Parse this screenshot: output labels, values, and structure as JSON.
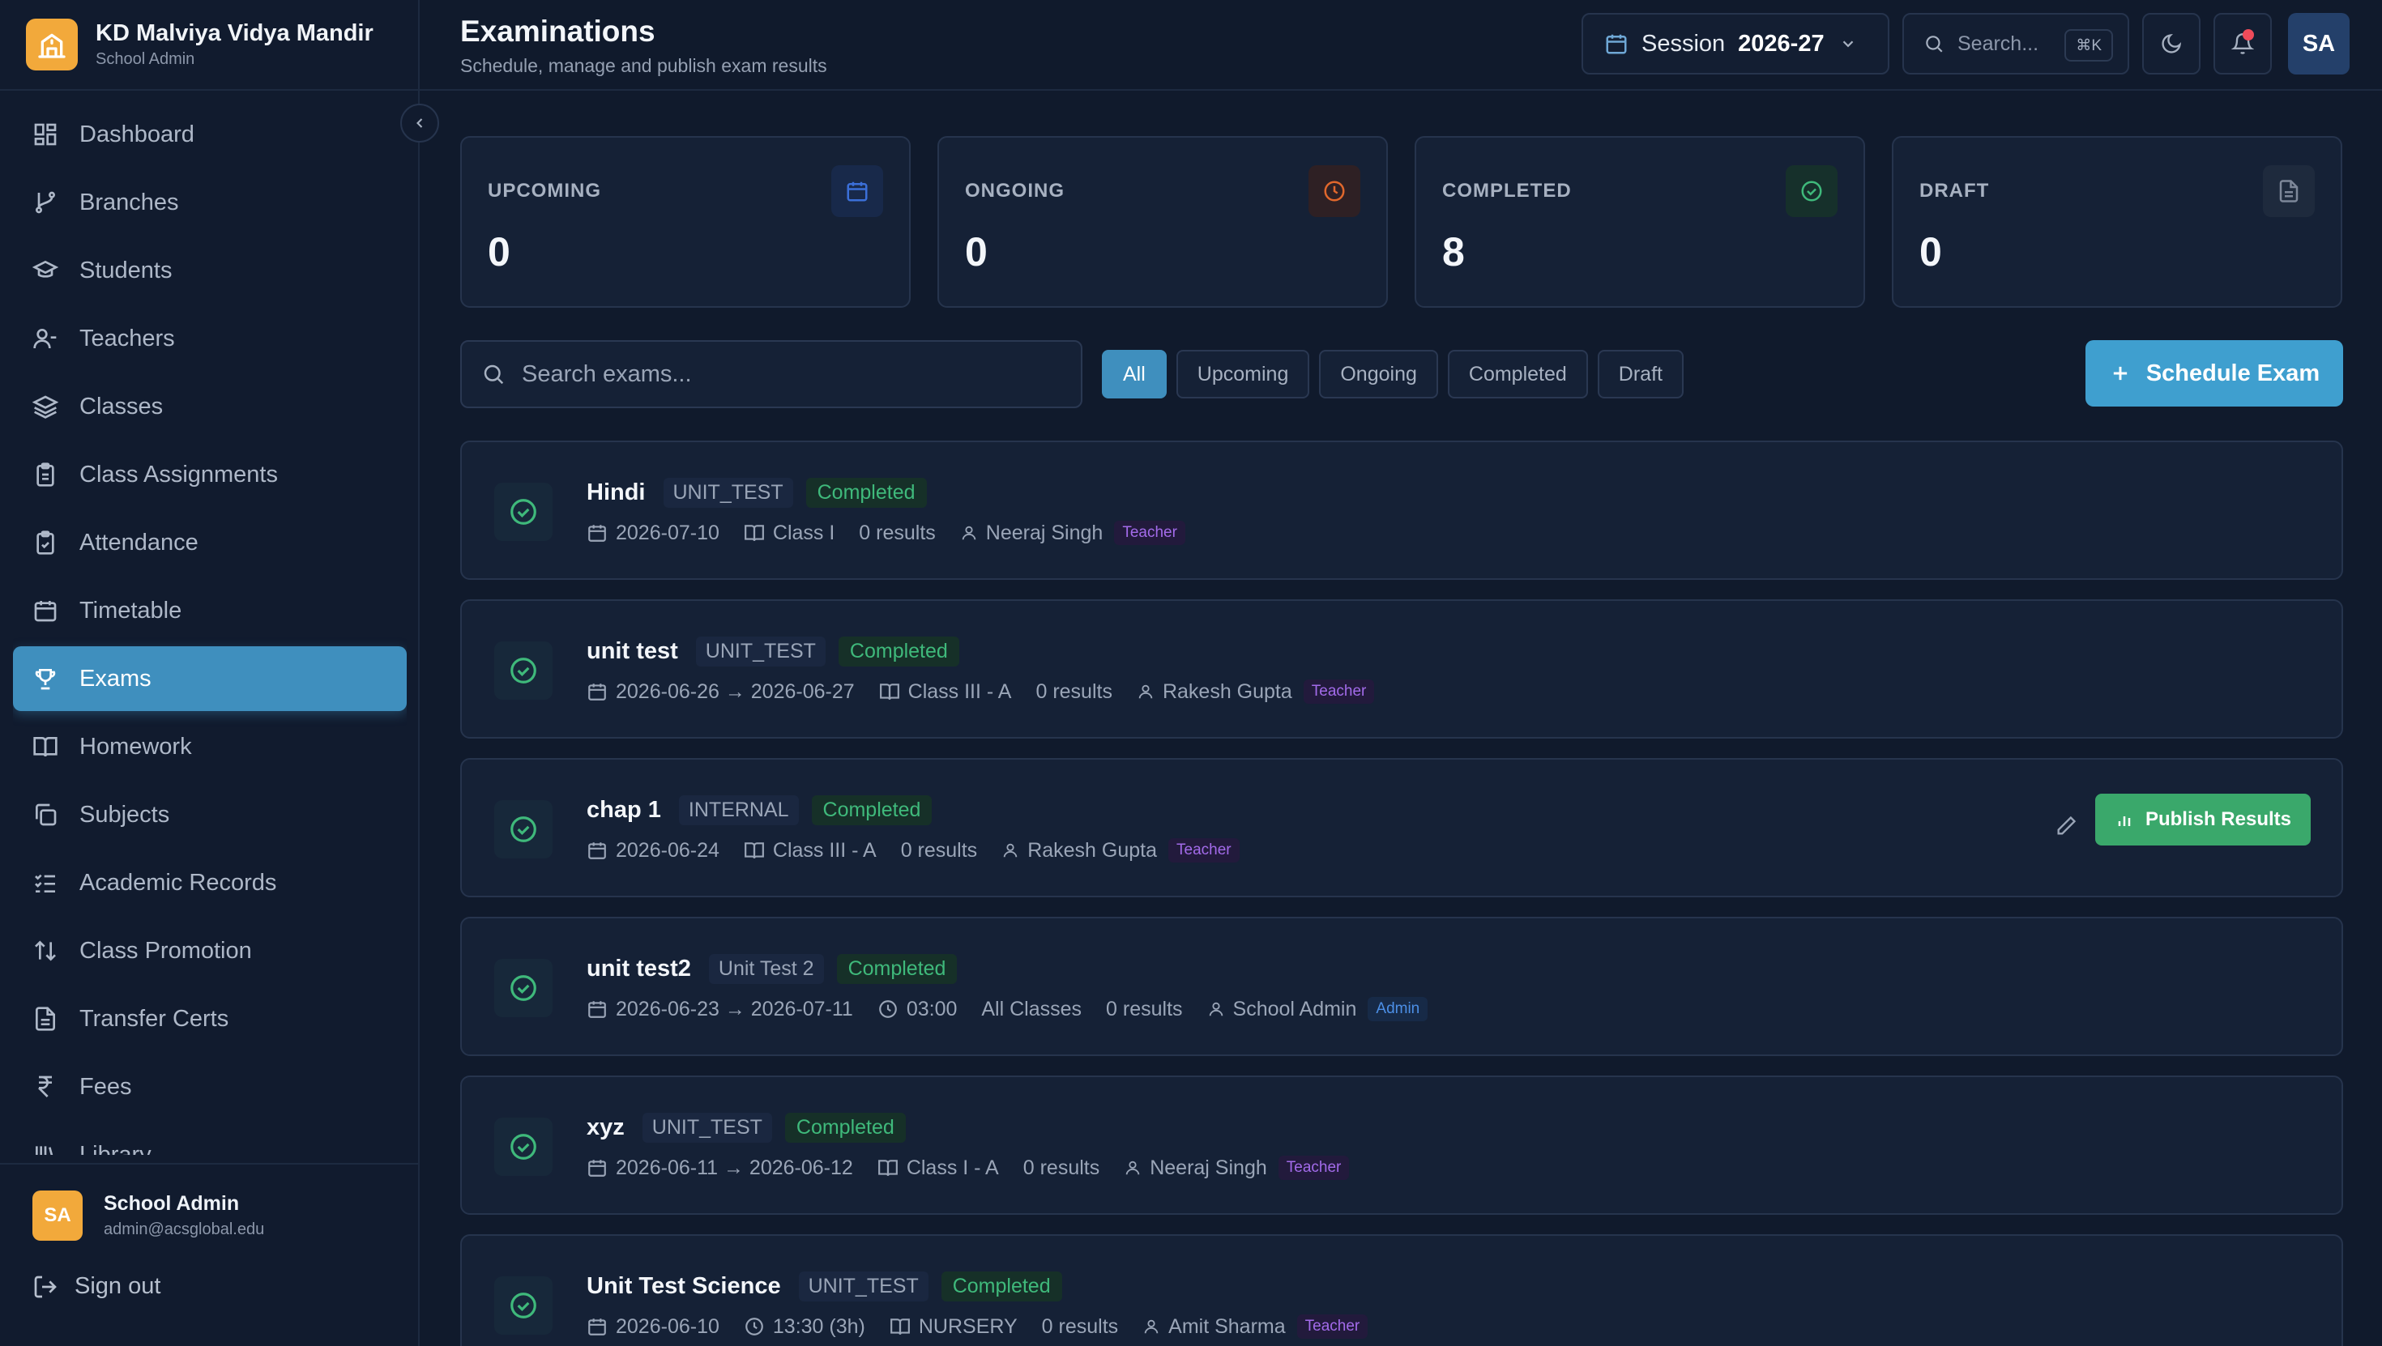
{
  "sidebar": {
    "brand_title": "KD Malviya Vidya Mandir",
    "brand_sub": "School Admin",
    "items": [
      {
        "label": "Dashboard",
        "icon": "dashboard-icon"
      },
      {
        "label": "Branches",
        "icon": "branches-icon"
      },
      {
        "label": "Students",
        "icon": "graduation-cap-icon"
      },
      {
        "label": "Teachers",
        "icon": "user-icon"
      },
      {
        "label": "Classes",
        "icon": "layers-icon"
      },
      {
        "label": "Class Assignments",
        "icon": "clipboard-icon"
      },
      {
        "label": "Attendance",
        "icon": "clipboard-check-icon"
      },
      {
        "label": "Timetable",
        "icon": "calendar-icon"
      },
      {
        "label": "Exams",
        "icon": "trophy-icon",
        "active": true
      },
      {
        "label": "Homework",
        "icon": "book-icon"
      },
      {
        "label": "Subjects",
        "icon": "copy-icon"
      },
      {
        "label": "Academic Records",
        "icon": "list-check-icon"
      },
      {
        "label": "Class Promotion",
        "icon": "arrows-icon"
      },
      {
        "label": "Transfer Certs",
        "icon": "file-icon"
      },
      {
        "label": "Fees",
        "icon": "rupee-icon"
      },
      {
        "label": "Library",
        "icon": "library-icon"
      }
    ],
    "user": {
      "initials": "SA",
      "name": "School Admin",
      "email": "admin@acsglobal.edu"
    },
    "signout_label": "Sign out"
  },
  "header": {
    "title": "Examinations",
    "subtitle": "Schedule, manage and publish exam results",
    "session_label": "Session",
    "session_value": "2026-27",
    "search_placeholder": "Search...",
    "search_shortcut": "⌘K",
    "avatar_initials": "SA"
  },
  "stats": [
    {
      "label": "UPCOMING",
      "value": "0",
      "color": "#3b6fd8"
    },
    {
      "label": "ONGOING",
      "value": "0",
      "color": "#e0672c"
    },
    {
      "label": "COMPLETED",
      "value": "8",
      "color": "#3fb97b"
    },
    {
      "label": "DRAFT",
      "value": "0",
      "color": "#7d8799"
    }
  ],
  "filters": {
    "search_placeholder": "Search exams...",
    "chips": [
      "All",
      "Upcoming",
      "Ongoing",
      "Completed",
      "Draft"
    ],
    "active": "All",
    "schedule_label": "Schedule Exam"
  },
  "exams": [
    {
      "name": "Hindi",
      "type": "UNIT_TEST",
      "status": "Completed",
      "date": "2026-07-10",
      "time": "",
      "class": "Class I",
      "results": "0 results",
      "person": "Neeraj Singh",
      "role": "Teacher"
    },
    {
      "name": "unit test",
      "type": "UNIT_TEST",
      "status": "Completed",
      "date": "2026-06-26 → 2026-06-27",
      "time": "",
      "class": "Class III - A",
      "results": "0 results",
      "person": "Rakesh Gupta",
      "role": "Teacher"
    },
    {
      "name": "chap 1",
      "type": "INTERNAL",
      "status": "Completed",
      "date": "2026-06-24",
      "time": "",
      "class": "Class III - A",
      "results": "0 results",
      "person": "Rakesh Gupta",
      "role": "Teacher",
      "publish_label": "Publish Results"
    },
    {
      "name": "unit test2",
      "type": "Unit Test 2",
      "status": "Completed",
      "date": "2026-06-23 → 2026-07-11",
      "time": "03:00",
      "class": "All Classes",
      "results": "0 results",
      "person": "School Admin",
      "role": "Admin"
    },
    {
      "name": "xyz",
      "type": "UNIT_TEST",
      "status": "Completed",
      "date": "2026-06-11 → 2026-06-12",
      "time": "",
      "class": "Class I - A",
      "results": "0 results",
      "person": "Neeraj Singh",
      "role": "Teacher"
    },
    {
      "name": "Unit Test Science",
      "type": "UNIT_TEST",
      "status": "Completed",
      "date": "2026-06-10",
      "time": "13:30 (3h)",
      "class": "NURSERY",
      "results": "0 results",
      "person": "Amit Sharma",
      "role": "Teacher"
    }
  ]
}
